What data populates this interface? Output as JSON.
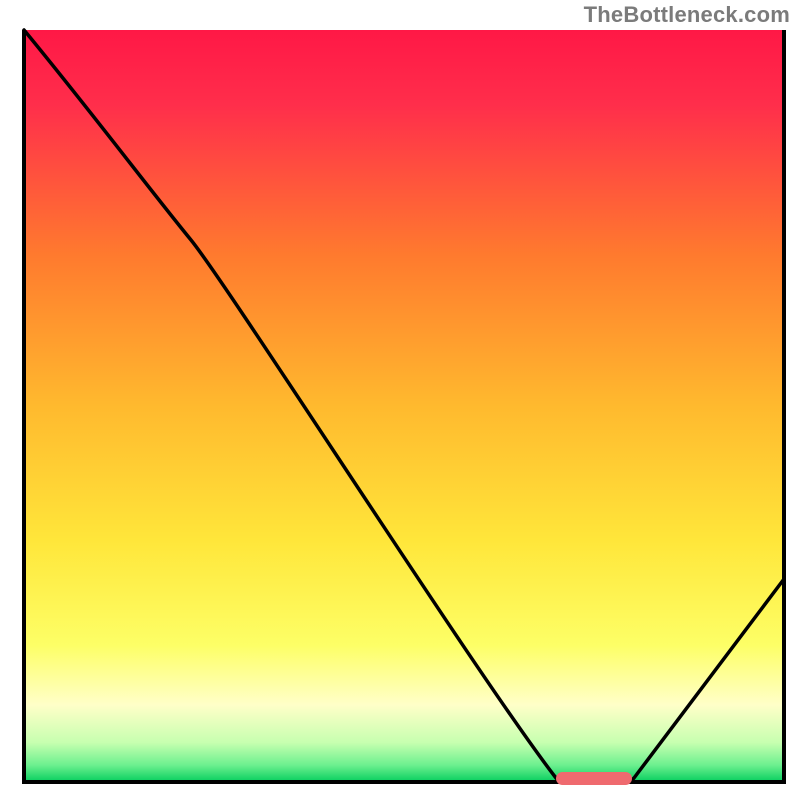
{
  "watermark": "TheBottleneck.com",
  "chart_data": {
    "type": "line",
    "title": "",
    "xlabel": "",
    "ylabel": "",
    "xlim": [
      0,
      100
    ],
    "ylim": [
      0,
      100
    ],
    "series": [
      {
        "name": "bottleneck-curve",
        "x": [
          0,
          22,
          70,
          80,
          100
        ],
        "y": [
          100,
          72,
          0,
          0,
          27
        ]
      }
    ],
    "marker": {
      "name": "optimal-range",
      "x_range": [
        70,
        80
      ],
      "y": 0,
      "color": "#ef6a6f"
    },
    "background_gradient": {
      "top": "#ff1e4a",
      "mid1": "#ff8a2a",
      "mid2": "#ffe63a",
      "pale": "#ffffc0",
      "bottom": "#1fd86b"
    },
    "axes_visible": false,
    "grid": false
  }
}
